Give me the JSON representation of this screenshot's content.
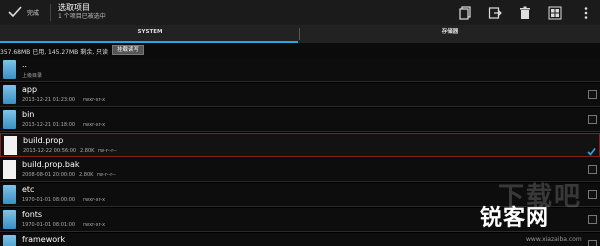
{
  "actionbar": {
    "done_label": "完成",
    "title": "选取项目",
    "subtitle": "1 个项目已被选中"
  },
  "tabs": [
    {
      "label": "SYSTEM",
      "active": true
    },
    {
      "label": "存储器",
      "active": false
    }
  ],
  "status": {
    "text": "357.68MB 已用, 145.27MB 剩余, 只读",
    "mount_button": "挂载读写"
  },
  "files": [
    {
      "name": "..",
      "date": "上级目录",
      "size": "",
      "perm": "",
      "type": "folder",
      "checkbox": false,
      "checked": false,
      "selected": false
    },
    {
      "name": "app",
      "date": "2013-12-21 01:23:00",
      "size": "",
      "perm": "rwxr-xr-x",
      "type": "folder",
      "checkbox": true,
      "checked": false,
      "selected": false
    },
    {
      "name": "bin",
      "date": "2013-12-21 01:18:00",
      "size": "",
      "perm": "rwxr-xr-x",
      "type": "folder",
      "checkbox": true,
      "checked": false,
      "selected": false
    },
    {
      "name": "build.prop",
      "date": "2013-12-22 00:56:00",
      "size": "2.80K",
      "perm": "rw-r--r--",
      "type": "file",
      "checkbox": true,
      "checked": true,
      "selected": true
    },
    {
      "name": "build.prop.bak",
      "date": "2008-08-01 20:00:00",
      "size": "2.80K",
      "perm": "rw-r--r--",
      "type": "file",
      "checkbox": true,
      "checked": false,
      "selected": false
    },
    {
      "name": "etc",
      "date": "1970-01-01 08:00:00",
      "size": "",
      "perm": "rwxr-xr-x",
      "type": "folder",
      "checkbox": true,
      "checked": false,
      "selected": false
    },
    {
      "name": "fonts",
      "date": "1970-01-01 08:01:00",
      "size": "",
      "perm": "rwxr-xr-x",
      "type": "folder",
      "checkbox": true,
      "checked": false,
      "selected": false
    },
    {
      "name": "framework",
      "date": "1970-01-01 08:00:00",
      "size": "",
      "perm": "rwxr-xr-x",
      "type": "folder",
      "checkbox": true,
      "checked": false,
      "selected": false
    }
  ],
  "watermark": {
    "big": "下载吧",
    "logo": "锐客网",
    "url": "www.xiazaiba.com"
  },
  "colors": {
    "accent": "#2aa7e0",
    "selected_border": "#8b1d1d",
    "folder": "#5aa9d6"
  }
}
